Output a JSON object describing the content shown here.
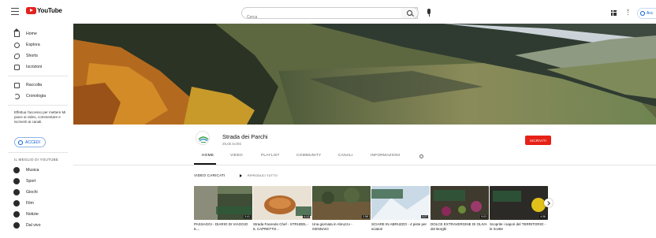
{
  "topbar": {
    "logo_text": "YouTube",
    "search_placeholder": "Cerca",
    "signin_label": "Acc"
  },
  "sidebar": {
    "items": [
      {
        "label": "Home",
        "icon": "home-icon"
      },
      {
        "label": "Esplora",
        "icon": "explore-icon"
      },
      {
        "label": "Shorts",
        "icon": "shorts-icon"
      },
      {
        "label": "Iscrizioni",
        "icon": "subscriptions-icon"
      },
      {
        "label": "Raccolta",
        "icon": "library-icon"
      },
      {
        "label": "Cronologia",
        "icon": "history-icon"
      }
    ],
    "note": "Effettua l'accesso per mettere Mi piace ai video, commentare e iscriverti ai canali.",
    "login_label": "ACCEDI",
    "section_title": "IL MEGLIO DI YOUTUBE",
    "best_of": [
      {
        "label": "Musica"
      },
      {
        "label": "Sport"
      },
      {
        "label": "Giochi"
      },
      {
        "label": "Film"
      },
      {
        "label": "Notizie"
      },
      {
        "label": "Dal vivo"
      }
    ]
  },
  "channel": {
    "name": "Strada dei Parchi",
    "handle": "25,6k iscritti",
    "subscribe_label": "ISCRIVITI"
  },
  "tabs": [
    "HOME",
    "VIDEO",
    "PLAYLIST",
    "COMMUNITY",
    "CANALI",
    "INFORMAZIONI"
  ],
  "shelf": {
    "title": "VIDEO CARICATI",
    "play_all": "RIPRODUCI TUTTO"
  },
  "videos": [
    {
      "title": "PASSAGGI - DIARIO DI VIAGGIO IL...",
      "duration": "3:41"
    },
    {
      "title": "Strada Facendo Chef - STRUDEL - IL CAPRETTO...",
      "duration": "4:12"
    },
    {
      "title": "Una giornata in Abruzzo - GENNAIO",
      "duration": "2:58"
    },
    {
      "title": "SCIARE IN ABRUZZO - 4 piste per sciatori",
      "duration": "3:27"
    },
    {
      "title": "DOLCE EXTRAVERGINE DI OLIVA dei Borghi",
      "duration": "5:03"
    },
    {
      "title": "Scoprite i sapori del TERRITORIO - le ricette",
      "duration": "4:36"
    }
  ],
  "colors": {
    "accent_red": "#e62117",
    "link_blue": "#065fd4"
  }
}
